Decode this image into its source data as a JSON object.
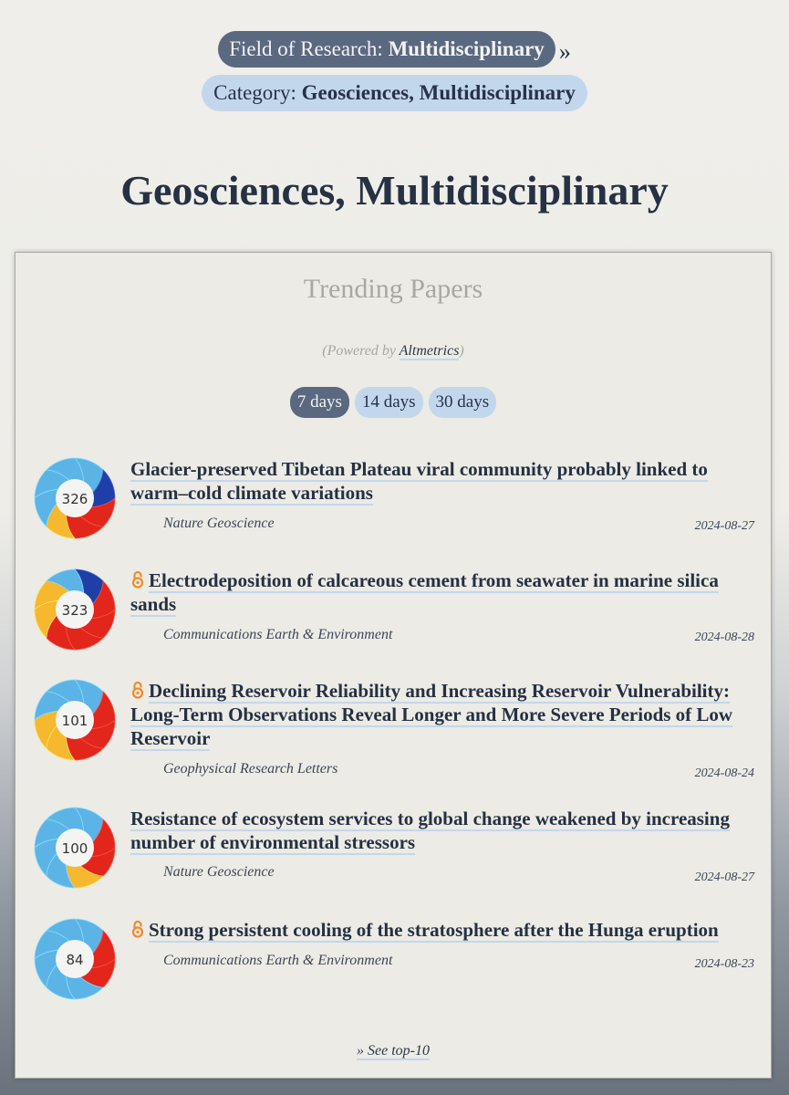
{
  "breadcrumb": {
    "field_prefix": "Field of Research: ",
    "field_value": "Multidisciplinary",
    "separator": "»",
    "category_prefix": "Category: ",
    "category_value": "Geosciences, Multidisciplinary"
  },
  "page_title": "Geosciences, Multidisciplinary",
  "panel": {
    "title": "Trending Papers",
    "powered_open": "(Powered by ",
    "powered_link": "Altmetrics",
    "powered_close": ")",
    "tabs": [
      {
        "label": "7 days",
        "active": true
      },
      {
        "label": "14 days",
        "active": false
      },
      {
        "label": "30 days",
        "active": false
      }
    ],
    "see_more": "» See top-10"
  },
  "papers": [
    {
      "score": "326",
      "open_access": false,
      "title": "Glacier-preserved Tibetan Plateau viral community probably linked to warm–cold climate variations",
      "journal": "Nature Geoscience",
      "date": "2024-08-27"
    },
    {
      "score": "323",
      "open_access": true,
      "title": "Electrodeposition of calcareous cement from seawater in marine silica sands",
      "journal": "Communications Earth & Environment",
      "date": "2024-08-28"
    },
    {
      "score": "101",
      "open_access": true,
      "title": "Declining Reservoir Reliability and Increasing Reservoir Vulnerability: Long-Term Observations Reveal Longer and More Severe Periods of Low Reservoir",
      "journal": "Geophysical Research Letters",
      "date": "2024-08-24"
    },
    {
      "score": "100",
      "open_access": false,
      "title": "Resistance of ecosystem services to global change weakened by increasing number of environmental stressors",
      "journal": "Nature Geoscience",
      "date": "2024-08-27"
    },
    {
      "score": "84",
      "open_access": true,
      "title": "Strong persistent cooling of the stratosphere after the Hunga eruption",
      "journal": "Communications Earth & Environment",
      "date": "2024-08-23"
    }
  ],
  "colors": {
    "pill_dark": "#5a6880",
    "pill_light": "#c3d7ec",
    "heading": "#263143",
    "open_access_icon": "#f08a2c",
    "altmetric_blue": "#5bb4e5",
    "altmetric_red": "#e2261c",
    "altmetric_yellow": "#f5b82e",
    "altmetric_navy": "#1f3fa8"
  }
}
